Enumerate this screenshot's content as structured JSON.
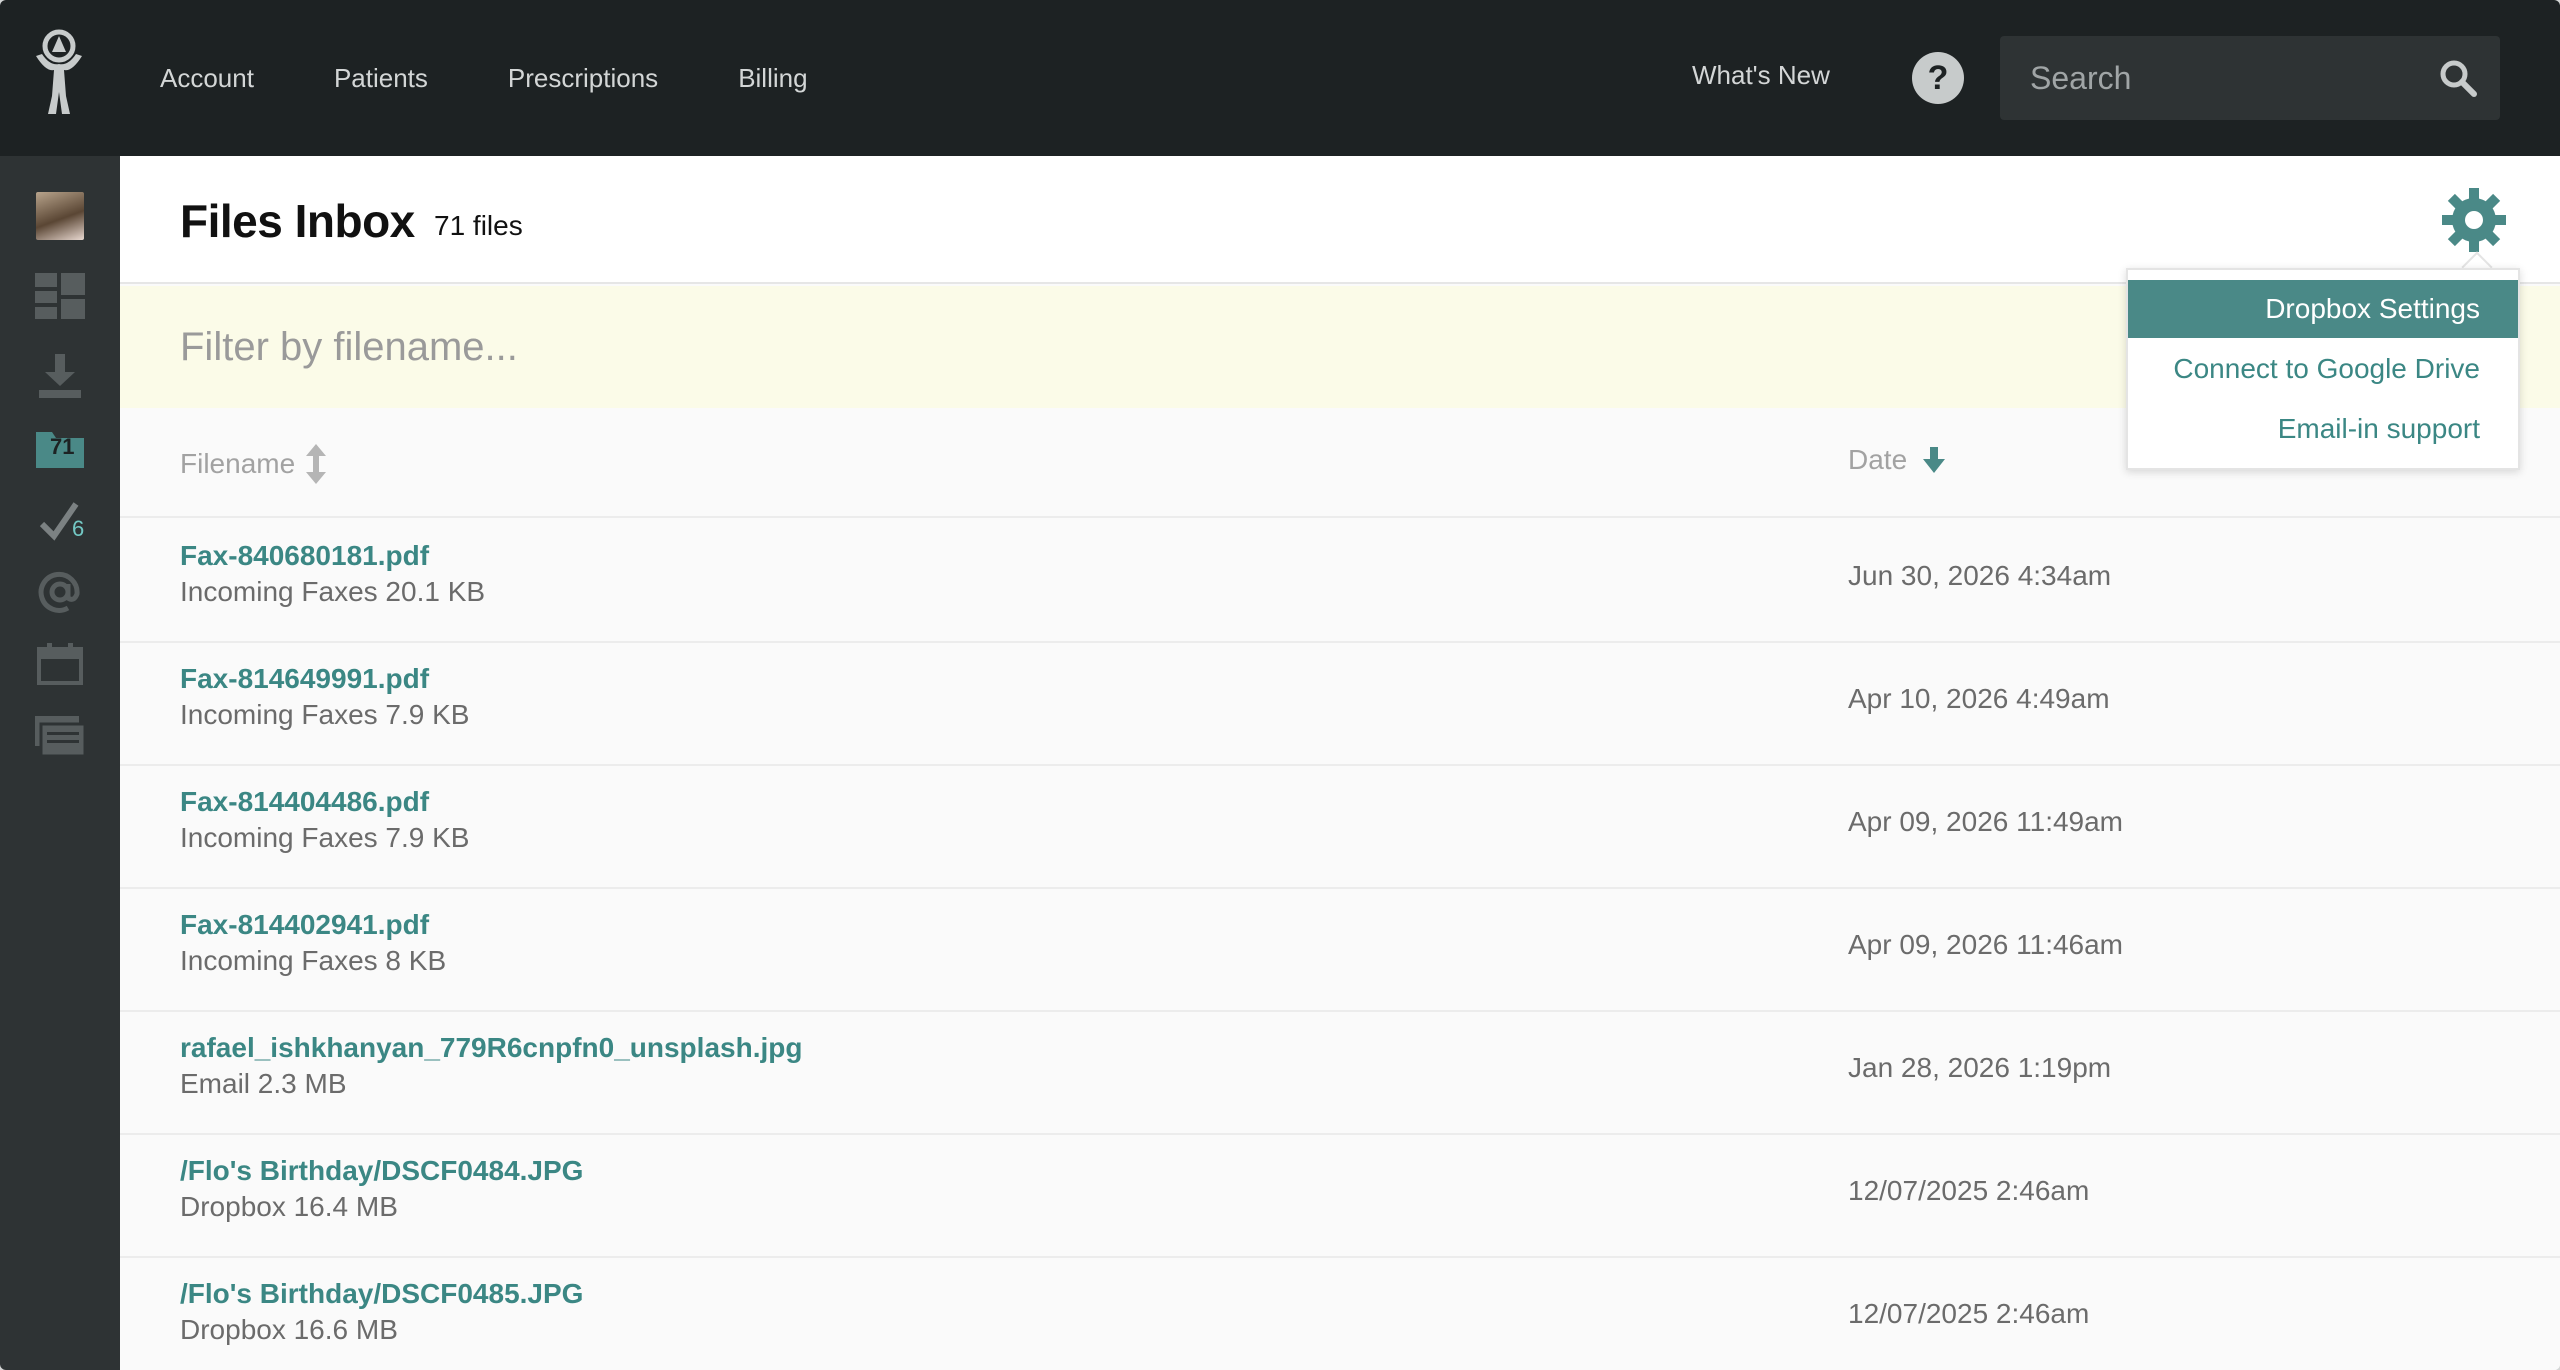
{
  "nav": {
    "items": [
      "Account",
      "Patients",
      "Prescriptions",
      "Billing"
    ],
    "whats_new": "What's New",
    "help": "?"
  },
  "search": {
    "placeholder": "Search"
  },
  "sidebar": {
    "items": [
      {
        "name": "avatar"
      },
      {
        "name": "dashboard-icon"
      },
      {
        "name": "download-icon"
      },
      {
        "name": "folder-icon",
        "badge": "71"
      },
      {
        "name": "check-icon",
        "badge": "6"
      },
      {
        "name": "at-icon"
      },
      {
        "name": "calendar-icon"
      },
      {
        "name": "messages-icon"
      }
    ]
  },
  "header": {
    "title": "Files Inbox",
    "count": "71 files"
  },
  "filter": {
    "placeholder": "Filter by filename..."
  },
  "columns": {
    "filename": "Filename",
    "date": "Date"
  },
  "files": [
    {
      "name": "Fax-840680181.pdf",
      "meta": "Incoming Faxes 20.1 KB",
      "date": "Jun 30, 2026 4:34am"
    },
    {
      "name": "Fax-814649991.pdf",
      "meta": "Incoming Faxes 7.9 KB",
      "date": "Apr 10, 2026 4:49am"
    },
    {
      "name": "Fax-814404486.pdf",
      "meta": "Incoming Faxes 7.9 KB",
      "date": "Apr 09, 2026 11:49am"
    },
    {
      "name": "Fax-814402941.pdf",
      "meta": "Incoming Faxes 8 KB",
      "date": "Apr 09, 2026 11:46am"
    },
    {
      "name": "rafael_ishkhanyan_779R6cnpfn0_unsplash.jpg",
      "meta": "Email 2.3 MB",
      "date": "Jan 28, 2026 1:19pm"
    },
    {
      "name": "/Flo's Birthday/DSCF0484.JPG",
      "meta": "Dropbox 16.4 MB",
      "date": "12/07/2025 2:46am"
    },
    {
      "name": "/Flo's Birthday/DSCF0485.JPG",
      "meta": "Dropbox 16.6 MB",
      "date": "12/07/2025 2:46am"
    }
  ],
  "dropdown": {
    "items": [
      "Dropbox Settings",
      "Connect to Google Drive",
      "Email-in support"
    ]
  },
  "colors": {
    "accent": "#4a8987",
    "link": "#3b8784",
    "topbar": "#1d2223",
    "sidebar": "#2e3334",
    "filter_bg": "#fbfbe8"
  }
}
